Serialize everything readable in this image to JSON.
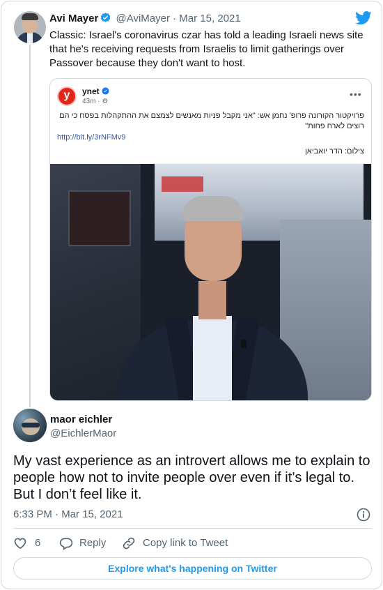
{
  "parent_tweet": {
    "name": "Avi Mayer",
    "handle": "@AviMayer",
    "separator": "·",
    "date": "Mar 15, 2021",
    "text": "Classic: Israel's coronavirus czar has told a leading Israeli news site that he's receiving requests from Israelis to limit gatherings over Passover because they don't want to host.",
    "verified_icon": "verified-badge-icon",
    "embedded_post": {
      "source_logo_letter": "y",
      "source_name": "ynet",
      "meta": "43m · ⚙",
      "more_label": "•••",
      "hebrew_text": "פרויקטור הקורונה פרופ' נחמן אש: \"אני מקבל פניות מאנשים לצמצם את ההתקהלות בפסח כי הם רוצים לארח פחות\"",
      "link": "http://bit.ly/3rNFMv9",
      "photo_credit": "צילום: הדר יואביאן"
    }
  },
  "reply_tweet": {
    "name": "maor eichler",
    "handle": "@EichlerMaor",
    "text": "My vast experience as an introvert allows me to explain to people how not to invite people over even if it’s legal to. But I don’t feel like it.",
    "timestamp": "6:33 PM · Mar 15, 2021"
  },
  "actions": {
    "like_count": "6",
    "reply_label": "Reply",
    "copy_link_label": "Copy link to Tweet"
  },
  "explore_button": "Explore what's happening on Twitter",
  "colors": {
    "twitter_blue": "#1d9bf0",
    "text_secondary": "#536471",
    "border": "#cfd9de",
    "ynet_red": "#e1251b"
  }
}
